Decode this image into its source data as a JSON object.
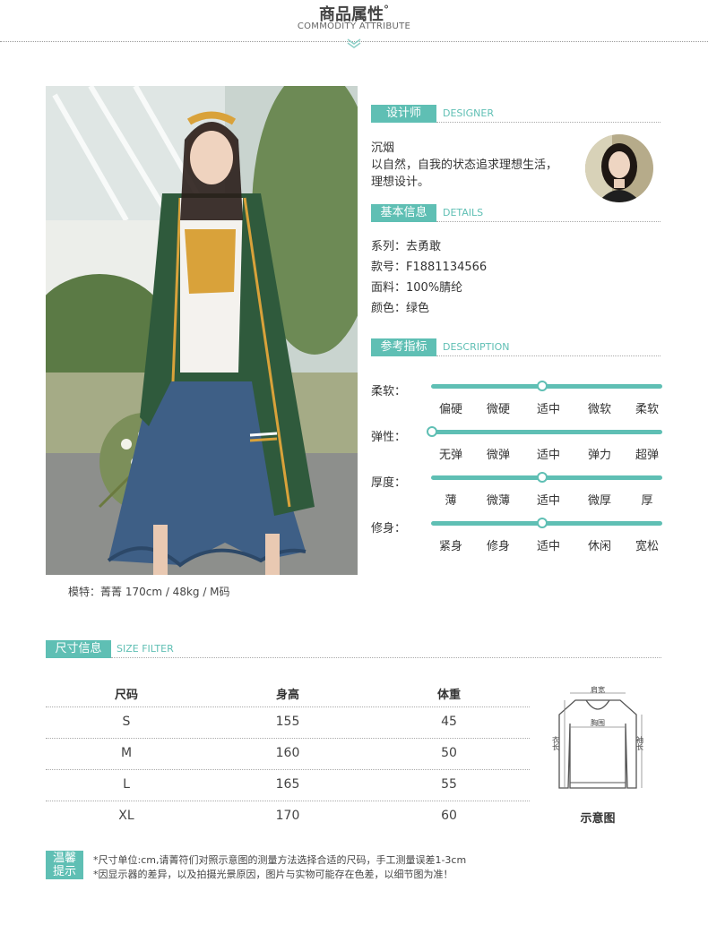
{
  "header": {
    "title": "商品属性",
    "degree": "°",
    "subtitle": "COMMODITY ATTRIBUTE"
  },
  "photo": {
    "caption": "模特：菁菁   170cm / 48kg / M码"
  },
  "designer": {
    "tag": "设计师",
    "tag_en": "DESIGNER",
    "name": "沉烟",
    "line1": "以自然，自我的状态追求理想生活，",
    "line2": "理想设计。"
  },
  "details": {
    "tag": "基本信息",
    "tag_en": "DETAILS",
    "items": [
      "系列：去勇敢",
      "款号：F1881134566",
      "面料：100%腈纶",
      "颜色：绿色"
    ]
  },
  "description": {
    "tag": "参考指标",
    "tag_en": "DESCRIPTION",
    "sliders": [
      {
        "label": "柔软：",
        "ticks": [
          "偏硬",
          "微硬",
          "适中",
          "微软",
          "柔软"
        ],
        "level": 3
      },
      {
        "label": "弹性：",
        "ticks": [
          "无弹",
          "微弹",
          "适中",
          "弹力",
          "超弹"
        ],
        "level": 1
      },
      {
        "label": "厚度：",
        "ticks": [
          "薄",
          "微薄",
          "适中",
          "微厚",
          "厚"
        ],
        "level": 3
      },
      {
        "label": "修身：",
        "ticks": [
          "紧身",
          "修身",
          "适中",
          "休闲",
          "宽松"
        ],
        "level": 3
      }
    ]
  },
  "size": {
    "tag": "尺寸信息",
    "tag_en": "SIZE FILTER",
    "headers": [
      "尺码",
      "身高",
      "体重"
    ],
    "rows": [
      [
        "S",
        "155",
        "45"
      ],
      [
        "M",
        "160",
        "50"
      ],
      [
        "L",
        "165",
        "55"
      ],
      [
        "XL",
        "170",
        "60"
      ]
    ],
    "diagram_caption": "示意图",
    "diagram_labels": {
      "shoulder": "肩宽",
      "chest": "胸围",
      "length": "衣长",
      "sleeve": "袖长"
    }
  },
  "tips": {
    "label_1": "温馨",
    "label_2": "提示",
    "line1": "*尺寸单位:cm,请菁符们对照示意图的测量方法选择合适的尺码，手工测量误差1-3cm",
    "line2": "*因显示器的差异，以及拍摄光景原因，图片与实物可能存在色差，以细节图为准！"
  },
  "colors": {
    "accent": "#5fbfb4",
    "cardigan": "#2f5a3c",
    "vest": "#d9a23a",
    "skirt": "#3e5f86"
  }
}
